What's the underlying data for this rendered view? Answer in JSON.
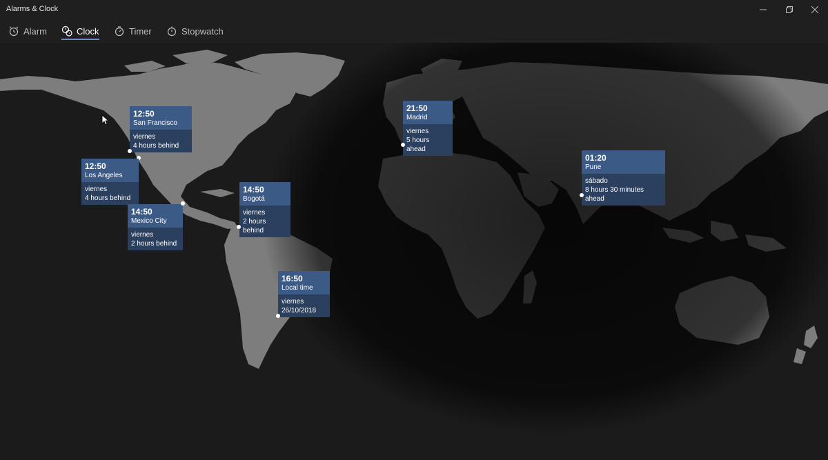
{
  "window": {
    "title": "Alarms & Clock"
  },
  "nav": {
    "tabs": [
      {
        "label": "Alarm",
        "icon": "alarm-icon"
      },
      {
        "label": "Clock",
        "icon": "clock-icon",
        "active": true
      },
      {
        "label": "Timer",
        "icon": "timer-icon"
      },
      {
        "label": "Stopwatch",
        "icon": "stopwatch-icon"
      }
    ]
  },
  "colors": {
    "accent": "#6b8ec8",
    "card_top": "#3c5a86",
    "card_bottom": "#2b3f5e",
    "land": "#7a7a7a",
    "night": "#111111"
  },
  "clocks": [
    {
      "time": "12:50",
      "place": "San Francisco",
      "day": "viernes",
      "offset": "4 hours behind"
    },
    {
      "time": "12:50",
      "place": "Los Angeles",
      "day": "viernes",
      "offset": "4 hours behind"
    },
    {
      "time": "14:50",
      "place": "Mexico City",
      "day": "viernes",
      "offset": "2 hours behind"
    },
    {
      "time": "14:50",
      "place": "Bogotá",
      "day": "viernes",
      "offset": "2 hours behind"
    },
    {
      "time": "16:50",
      "place": "Local time",
      "day": "viernes",
      "offset": "26/10/2018"
    },
    {
      "time": "21:50",
      "place": "Madrid",
      "day": "viernes",
      "offset": "5 hours ahead"
    },
    {
      "time": "01:20",
      "place": "Pune",
      "day": "sábado",
      "offset": "8 hours 30 minutes ahead"
    }
  ]
}
